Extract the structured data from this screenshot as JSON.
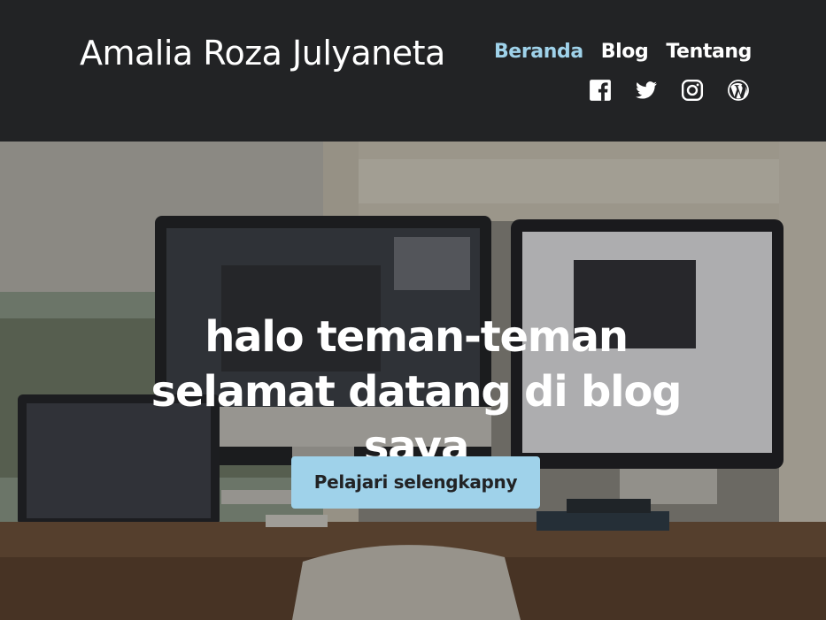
{
  "site": {
    "title": "Amalia Roza Julyaneta"
  },
  "nav": {
    "items": [
      {
        "label": "Beranda",
        "active": true
      },
      {
        "label": "Blog",
        "active": false
      },
      {
        "label": "Tentang",
        "active": false
      }
    ]
  },
  "social": {
    "icons": [
      "facebook-icon",
      "twitter-icon",
      "instagram-icon",
      "wordpress-icon"
    ]
  },
  "hero": {
    "title": "halo teman-teman selamat datang di blog saya",
    "button_label": "Pelajari selengkapny"
  },
  "colors": {
    "header_bg": "#222325",
    "accent": "#9fd2ea",
    "text": "#ffffff"
  }
}
